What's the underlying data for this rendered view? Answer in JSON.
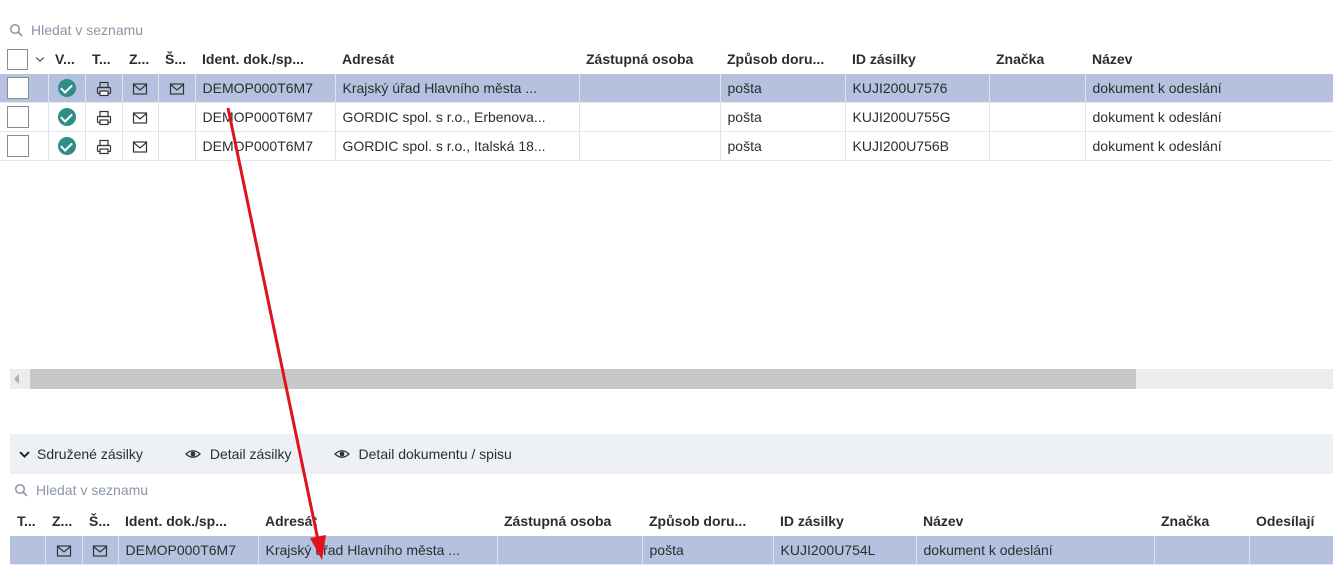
{
  "top": {
    "search": {
      "placeholder": "Hledat v seznamu"
    },
    "columns": [
      {
        "label": ""
      },
      {
        "label": "V..."
      },
      {
        "label": "T..."
      },
      {
        "label": "Z..."
      },
      {
        "label": "Š..."
      },
      {
        "label": "Ident. dok./sp..."
      },
      {
        "label": "Adresát"
      },
      {
        "label": "Zástupná osoba"
      },
      {
        "label": "Způsob doru..."
      },
      {
        "label": "ID zásilky"
      },
      {
        "label": "Značka"
      },
      {
        "label": "Název"
      }
    ],
    "rows": [
      {
        "ident": "DEMOP000T6M7",
        "adresat": "Krajský úřad Hlavního města ...",
        "zastupna": "",
        "zpusob": "pošta",
        "id": "KUJI200U7576",
        "znacka": "",
        "nazev": "dokument k odeslání"
      },
      {
        "ident": "DEMOP000T6M7",
        "adresat": "GORDIC spol. s r.o., Erbenova...",
        "zastupna": "",
        "zpusob": "pošta",
        "id": "KUJI200U755G",
        "znacka": "",
        "nazev": "dokument k odeslání"
      },
      {
        "ident": "DEMOP000T6M7",
        "adresat": "GORDIC spol. s r.o., Italská 18...",
        "zastupna": "",
        "zpusob": "pošta",
        "id": "KUJI200U756B",
        "znacka": "",
        "nazev": "dokument k odeslání"
      }
    ]
  },
  "tabs": [
    {
      "label": "Sdružené zásilky",
      "icon": "chevron-down-icon"
    },
    {
      "label": "Detail zásilky",
      "icon": "eye-icon"
    },
    {
      "label": "Detail dokumentu / spisu",
      "icon": "eye-icon"
    }
  ],
  "bottom": {
    "search": {
      "placeholder": "Hledat v seznamu"
    },
    "columns": [
      {
        "label": "T..."
      },
      {
        "label": "Z..."
      },
      {
        "label": "Š..."
      },
      {
        "label": "Ident. dok./sp..."
      },
      {
        "label": "Adresát"
      },
      {
        "label": "Zástupná osoba"
      },
      {
        "label": "Způsob doru..."
      },
      {
        "label": "ID zásilky"
      },
      {
        "label": "Název"
      },
      {
        "label": "Značka"
      },
      {
        "label": "Odesílají"
      }
    ],
    "rows": [
      {
        "ident": "DEMOP000T6M7",
        "adresat": "Krajský úřad Hlavního města ...",
        "zastupna": "",
        "zpusob": "pošta",
        "id": "KUJI200U754L",
        "nazev": "dokument k odeslání",
        "znacka": "",
        "odesilajici": ""
      }
    ]
  },
  "colors": {
    "selected_row": "#b4c2e0",
    "check_teal": "#2f8d87",
    "annotation_arrow": "#e0131b",
    "tabbar_bg": "#edf0f4"
  }
}
